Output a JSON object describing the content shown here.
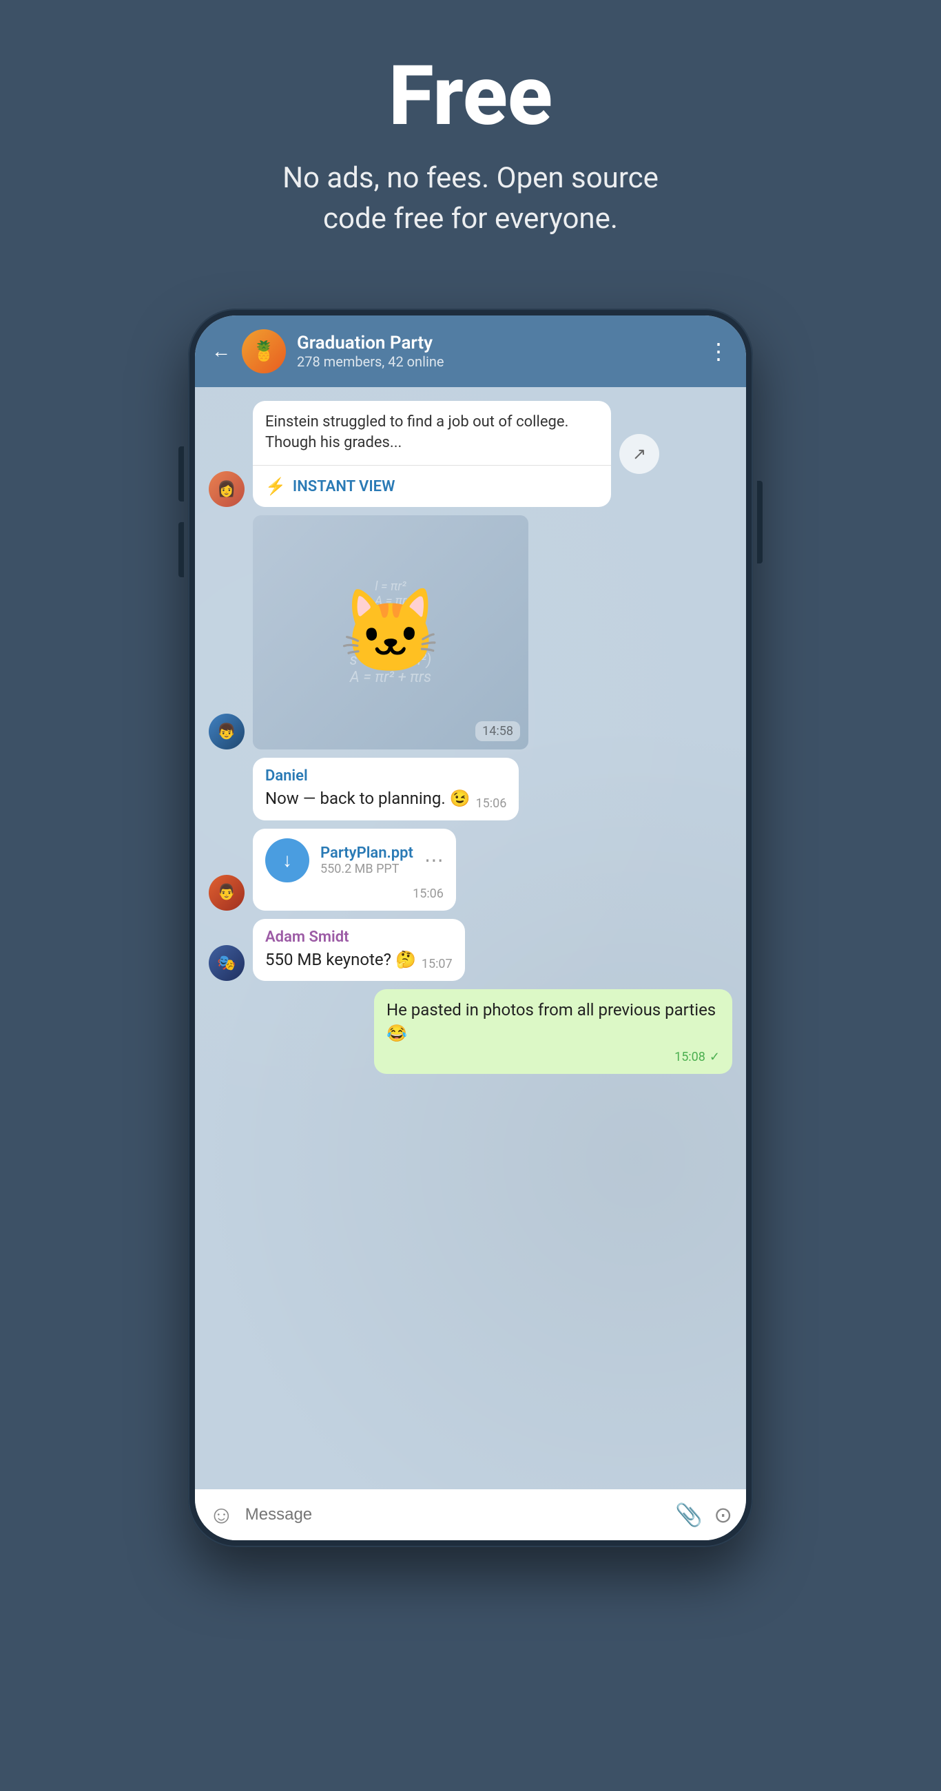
{
  "hero": {
    "title": "Free",
    "subtitle": "No ads, no fees. Open source\ncode free for everyone."
  },
  "phone": {
    "header": {
      "chat_name": "Graduation Party",
      "members_info": "278 members, 42 online",
      "back_label": "←",
      "more_label": "⋮"
    },
    "messages": [
      {
        "id": "msg-article",
        "type": "article",
        "text": "Einstein struggled to find a job out of college. Though his grades...",
        "instant_view_label": "INSTANT VIEW",
        "avatar_type": "girl"
      },
      {
        "id": "msg-sticker",
        "type": "sticker",
        "time": "14:58",
        "avatar_type": "boy"
      },
      {
        "id": "msg-daniel",
        "type": "text",
        "sender": "Daniel",
        "sender_color": "blue",
        "text": "Now — back to planning. 😉",
        "time": "15:06"
      },
      {
        "id": "msg-file",
        "type": "file",
        "file_name": "PartyPlan.ppt",
        "file_size": "550.2 MB PPT",
        "time": "15:06",
        "avatar_type": "man"
      },
      {
        "id": "msg-adam",
        "type": "text",
        "sender": "Adam Smidt",
        "sender_color": "purple",
        "text": "550 MB keynote? 🤔",
        "time": "15:07",
        "avatar_type": "other"
      },
      {
        "id": "msg-outgoing",
        "type": "outgoing",
        "text": "He pasted in photos from all previous parties 😂",
        "time": "15:08",
        "check": "✓"
      }
    ],
    "input": {
      "placeholder": "Message",
      "emoji_icon": "☺",
      "attach_icon": "🖇",
      "camera_icon": "⊙"
    }
  }
}
